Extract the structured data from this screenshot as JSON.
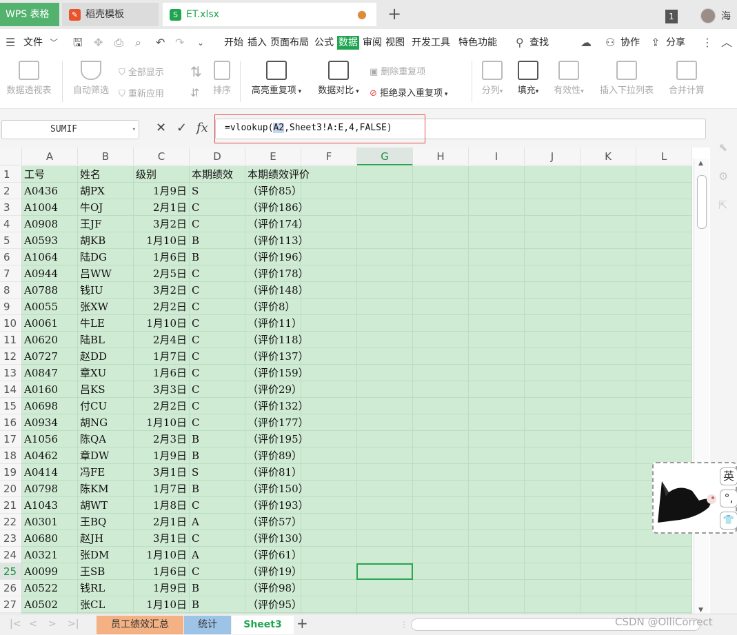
{
  "titlebar": {
    "wps_tab": "WPS 表格",
    "tabs": [
      {
        "label": "稻壳模板",
        "badge_color": "#e8532b"
      },
      {
        "label": "ET.xlsx",
        "badge": "S",
        "badge_color": "#1fa550",
        "modified_dot": "●"
      }
    ],
    "new_tab": "+",
    "window_counter": "1",
    "user_name": "海"
  },
  "menubar": {
    "file": "文件",
    "items": [
      "开始",
      "插入",
      "页面布局",
      "公式",
      "数据",
      "审阅",
      "视图",
      "开发工具",
      "特色功能"
    ],
    "active": "数据",
    "search": "查找",
    "collab": "协作",
    "share": "分享"
  },
  "ribbon": {
    "pivot": "数据透视表",
    "autofilter": "自动筛选",
    "show_all": "全部显示",
    "reapply": "重新应用",
    "sort": "排序",
    "highlight_dup": "高亮重复项",
    "compare": "数据对比",
    "delete_dup": "删除重复项",
    "reject_dup": "拒绝录入重复项",
    "split": "分列",
    "fill": "填充",
    "validity": "有效性",
    "dropdown": "插入下拉列表",
    "merge_calc": "合并计算"
  },
  "formula_bar": {
    "name_box": "SUMIF",
    "cancel": "✕",
    "confirm": "✓",
    "fx": "fx",
    "formula_prefix": "=vlookup(",
    "formula_ref": "A2",
    "formula_suffix": ",Sheet3!A:E,4,FALSE)"
  },
  "grid": {
    "columns": [
      "A",
      "B",
      "C",
      "D",
      "E",
      "F",
      "G",
      "H",
      "I",
      "J",
      "K",
      "L"
    ],
    "selected_column": "G",
    "selected_row": 25,
    "header_row": [
      "工号",
      "姓名",
      "级别",
      "本期绩效",
      "本期绩效评价"
    ],
    "rows": [
      [
        "A0436",
        "胡PX",
        "1月9日",
        "S",
        "（评价85）"
      ],
      [
        "A1004",
        "牛OJ",
        "2月1日",
        "C",
        "（评价186）"
      ],
      [
        "A0908",
        "王JF",
        "3月2日",
        "C",
        "（评价174）"
      ],
      [
        "A0593",
        "胡KB",
        "1月10日",
        "B",
        "（评价113）"
      ],
      [
        "A1064",
        "陆DG",
        "1月6日",
        "B",
        "（评价196）"
      ],
      [
        "A0944",
        "吕WW",
        "2月5日",
        "C",
        "（评价178）"
      ],
      [
        "A0788",
        "钱IU",
        "3月2日",
        "C",
        "（评价148）"
      ],
      [
        "A0055",
        "张XW",
        "2月2日",
        "C",
        "（评价8）"
      ],
      [
        "A0061",
        "牛LE",
        "1月10日",
        "C",
        "（评价11）"
      ],
      [
        "A0620",
        "陆BL",
        "2月4日",
        "C",
        "（评价118）"
      ],
      [
        "A0727",
        "赵DD",
        "1月7日",
        "C",
        "（评价137）"
      ],
      [
        "A0847",
        "章XU",
        "1月6日",
        "C",
        "（评价159）"
      ],
      [
        "A0160",
        "吕KS",
        "3月3日",
        "C",
        "（评价29）"
      ],
      [
        "A0698",
        "付CU",
        "2月2日",
        "C",
        "（评价132）"
      ],
      [
        "A0934",
        "胡NG",
        "1月10日",
        "C",
        "（评价177）"
      ],
      [
        "A1056",
        "陈QA",
        "2月3日",
        "B",
        "（评价195）"
      ],
      [
        "A0462",
        "章DW",
        "1月9日",
        "B",
        "（评价89）"
      ],
      [
        "A0414",
        "冯FE",
        "3月1日",
        "S",
        "（评价81）"
      ],
      [
        "A0798",
        "陈KM",
        "1月7日",
        "B",
        "（评价150）"
      ],
      [
        "A1043",
        "胡WT",
        "1月8日",
        "C",
        "（评价193）"
      ],
      [
        "A0301",
        "王BQ",
        "2月1日",
        "A",
        "（评价57）"
      ],
      [
        "A0680",
        "赵JH",
        "3月1日",
        "C",
        "（评价130）"
      ],
      [
        "A0321",
        "张DM",
        "1月10日",
        "A",
        "（评价61）"
      ],
      [
        "A0099",
        "王SB",
        "1月6日",
        "C",
        "（评价19）"
      ],
      [
        "A0522",
        "钱RL",
        "1月9日",
        "B",
        "（评价98）"
      ],
      [
        "A0502",
        "张CL",
        "1月10日",
        "B",
        "（评价95）"
      ]
    ]
  },
  "sheets": {
    "tabs": [
      {
        "label": "员工绩效汇总",
        "color": "#f4b183"
      },
      {
        "label": "统计",
        "color": "#9dc3e6"
      },
      {
        "label": "Sheet3",
        "color": "#ffffff"
      }
    ],
    "active": "Sheet3",
    "add": "+"
  },
  "ime": {
    "lang": "英",
    "punct": "°,",
    "skin": "👕"
  },
  "watermark": "CSDN @OlliCorrect"
}
